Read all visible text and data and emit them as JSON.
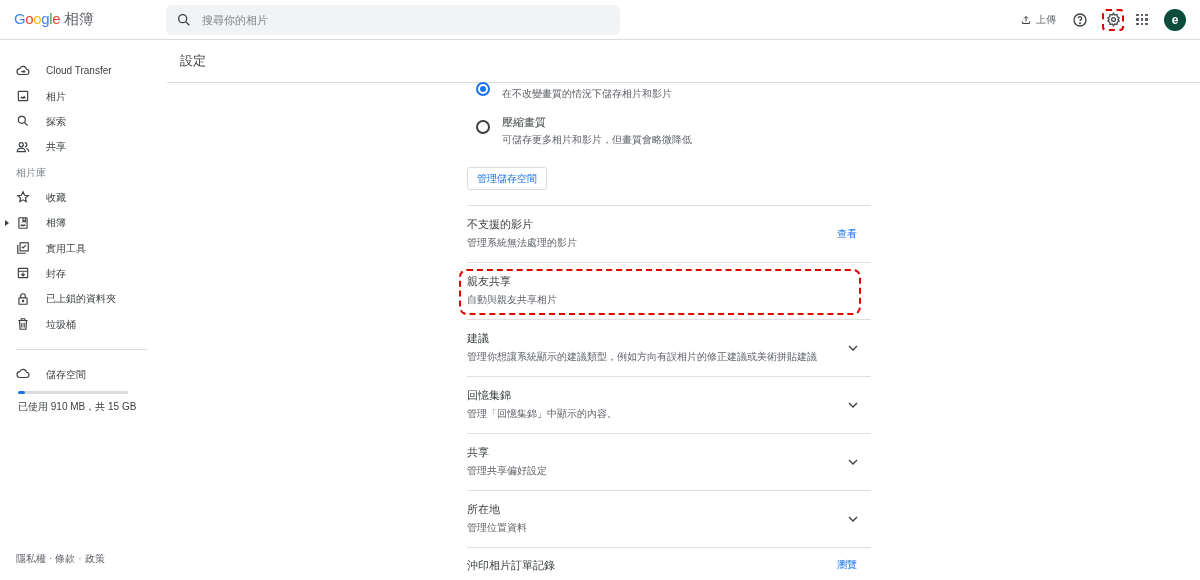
{
  "header": {
    "logo": "Google",
    "product": "相簿",
    "search": {
      "placeholder": "搜尋你的相片"
    },
    "upload": "上傳",
    "settings_highlighted": true,
    "avatar": "e"
  },
  "sidebar": {
    "items": [
      {
        "kind": "cloud-transfer",
        "label": "Cloud Transfer",
        "expandable": false
      },
      {
        "kind": "photo",
        "label": "相片",
        "expandable": false
      },
      {
        "kind": "search",
        "label": "探索",
        "expandable": false
      },
      {
        "kind": "people",
        "label": "共享",
        "expandable": false
      },
      {
        "kind": "heading",
        "label": "相片庫"
      },
      {
        "kind": "star",
        "label": "收藏",
        "expandable": false
      },
      {
        "kind": "album",
        "label": "相簿",
        "expandable": true
      },
      {
        "kind": "utilities",
        "label": "實用工具",
        "expandable": false
      },
      {
        "kind": "archive",
        "label": "封存",
        "expandable": false
      },
      {
        "kind": "lock",
        "label": "已上鎖的資料夾",
        "expandable": false
      },
      {
        "kind": "trash",
        "label": "垃圾桶",
        "expandable": false
      }
    ],
    "storage": {
      "label": "儲存空間",
      "level": 0.06,
      "usage": "已使用 910 MB，共 15 GB"
    },
    "footer": [
      "隱私權",
      "條款",
      "政策"
    ],
    "footer_separator": "·"
  },
  "page": {
    "title": "設定",
    "quality_options": [
      {
        "description": "在不改變畫質的情況下儲存相片和影片",
        "selected": true
      },
      {
        "title": "壓縮畫質",
        "description": "可儲存更多相片和影片，但畫質會略微降低",
        "selected": false
      }
    ],
    "manage_button": "管理儲存空間",
    "rows": [
      {
        "kind": "link",
        "title": "不支援的影片",
        "description": "管理系統無法處理的影片",
        "action": "查看",
        "highlighted": false
      },
      {
        "kind": "plain",
        "title": "親友共享",
        "description": "自動與親友共享相片",
        "highlighted": true
      },
      {
        "kind": "expand",
        "title": "建議",
        "description": "管理你想讓系統顯示的建議類型，例如方向有誤相片的修正建議或美術拼貼建議",
        "highlighted": false
      },
      {
        "kind": "expand",
        "title": "回憶集錦",
        "description": "管理「回憶集錦」中顯示的內容。",
        "highlighted": false
      },
      {
        "kind": "expand",
        "title": "共享",
        "description": "管理共享偏好設定",
        "highlighted": false
      },
      {
        "kind": "expand",
        "title": "所在地",
        "description": "管理位置資料",
        "highlighted": false
      },
      {
        "kind": "link",
        "title": "沖印相片訂單記錄",
        "action": "瀏覽",
        "highlighted": false
      }
    ]
  }
}
